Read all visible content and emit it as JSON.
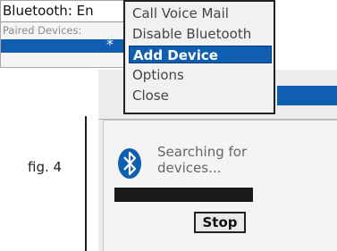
{
  "bluetooth_screen": {
    "title": "Bluetooth: En",
    "section_label": "Paired Devices:",
    "selected_row_text": "*"
  },
  "menu": {
    "items": [
      {
        "label": "Call Voice Mail"
      },
      {
        "label": "Disable Bluetooth"
      },
      {
        "label": "Add Device",
        "selected": true
      },
      {
        "label": "Options"
      },
      {
        "label": "Close"
      }
    ]
  },
  "caption": "fig. 4",
  "search_dialog": {
    "icon": "bluetooth-icon",
    "message": "Searching for devices...",
    "stop_label": "Stop"
  },
  "colors": {
    "highlight": "#0f5eb0",
    "progress": "#1a1a1a"
  }
}
